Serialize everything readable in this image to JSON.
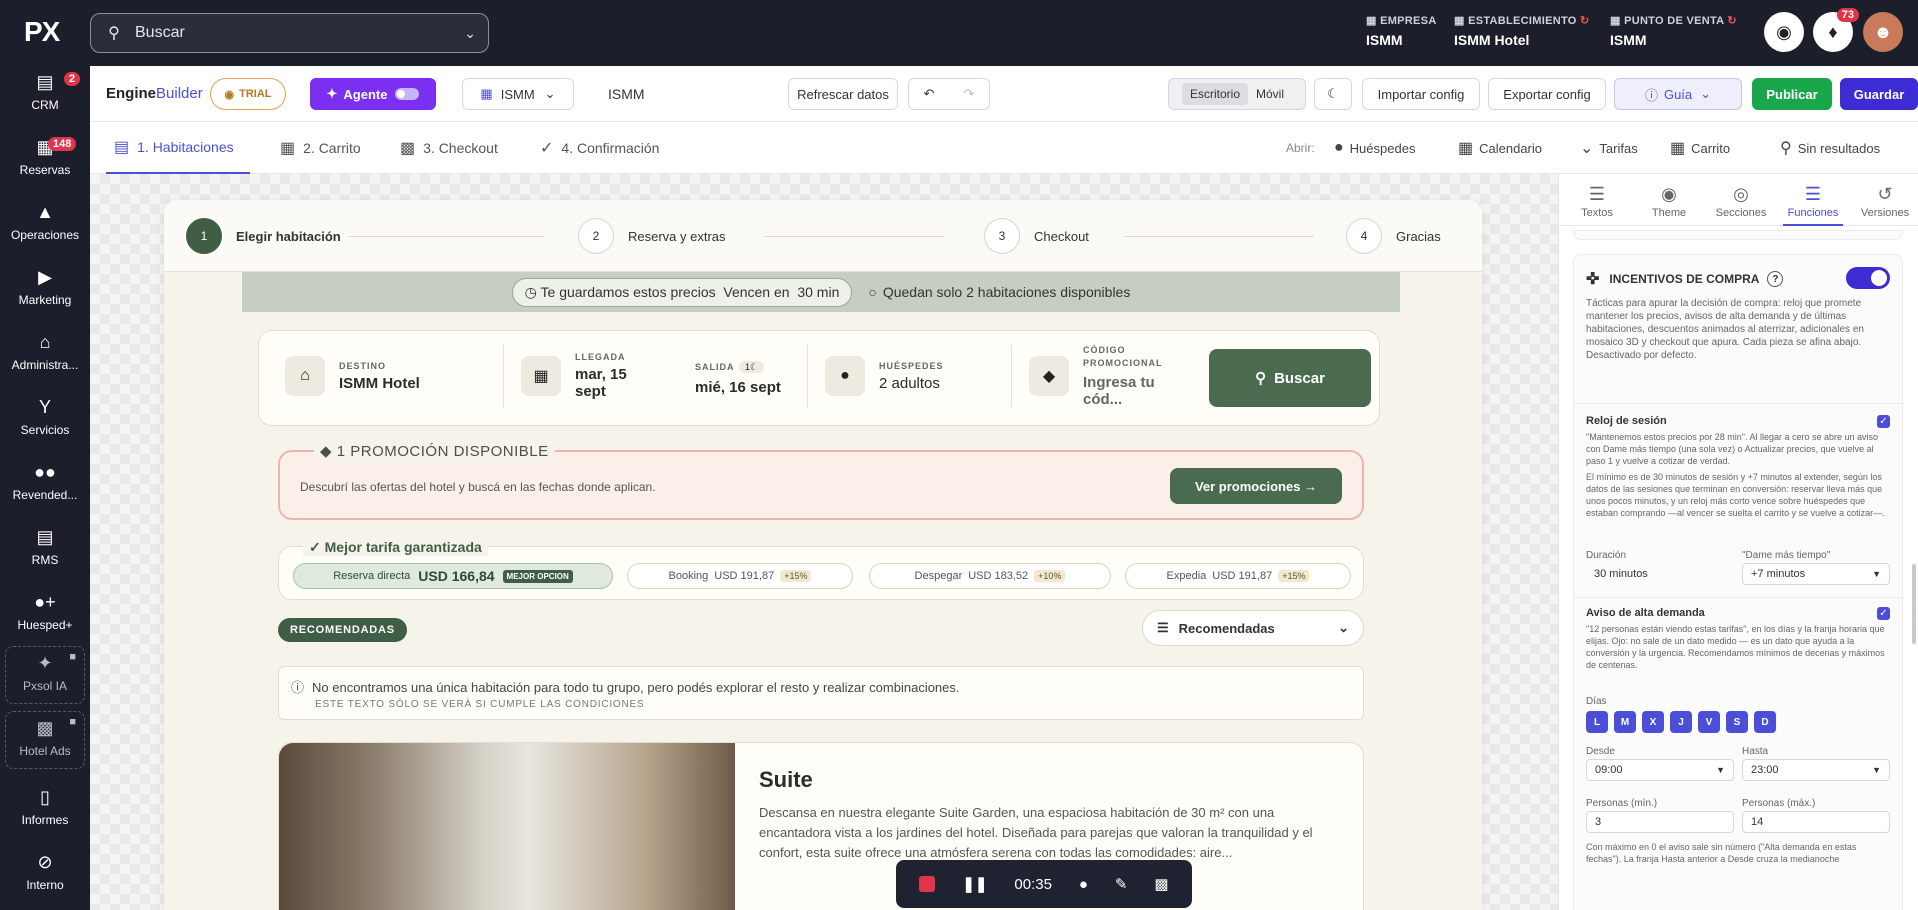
{
  "topbar": {
    "logo": "PX",
    "search_placeholder": "Buscar",
    "empresa_label": "EMPRESA",
    "empresa_value": "ISMM",
    "establecimiento_label": "ESTABLECIMIENTO",
    "establecimiento_value": "ISMM Hotel",
    "pdv_label": "PUNTO DE VENTA",
    "pdv_value": "ISMM",
    "notifications_count": "73"
  },
  "sidebar": {
    "items": [
      {
        "label": "CRM",
        "icon": "chat-icon",
        "badge": "2"
      },
      {
        "label": "Reservas",
        "icon": "calendar-icon",
        "badge": "148"
      },
      {
        "label": "Operaciones",
        "icon": "bell-icon"
      },
      {
        "label": "Marketing",
        "icon": "megaphone-icon"
      },
      {
        "label": "Administra...",
        "icon": "home-icon"
      },
      {
        "label": "Servicios",
        "icon": "cocktail-icon"
      },
      {
        "label": "Revended...",
        "icon": "users-icon"
      },
      {
        "label": "RMS",
        "icon": "chart-icon"
      },
      {
        "label": "Huesped+",
        "icon": "user-plus-icon"
      },
      {
        "label": "Pxsol IA",
        "icon": "sparkle-icon"
      },
      {
        "label": "Hotel Ads",
        "icon": "bars-icon"
      },
      {
        "label": "Informes",
        "icon": "document-icon"
      },
      {
        "label": "Interno",
        "icon": "block-icon"
      }
    ]
  },
  "toolbar": {
    "brand_a": "Engine",
    "brand_b": "Builder",
    "trial": "TRIAL",
    "agent": "Agente",
    "property": "ISMM",
    "property_name": "ISMM",
    "refresh": "Refrescar datos",
    "desktop": "Escritorio",
    "mobile": "Móvil",
    "import": "Importar config",
    "export": "Exportar config",
    "guide": "Guía",
    "publish": "Publicar",
    "save": "Guardar"
  },
  "steps_tabs": [
    {
      "label": "1. Habitaciones"
    },
    {
      "label": "2. Carrito"
    },
    {
      "label": "3. Checkout"
    },
    {
      "label": "4. Confirmación"
    }
  ],
  "open_links": {
    "label": "Abrir:",
    "items": [
      "Huéspedes",
      "Calendario",
      "Tarifas",
      "Carrito",
      "Sin resultados"
    ]
  },
  "preview": {
    "steps": [
      {
        "n": "1",
        "label": "Elegir habitación"
      },
      {
        "n": "2",
        "label": "Reserva y extras"
      },
      {
        "n": "3",
        "label": "Checkout"
      },
      {
        "n": "4",
        "label": "Gracias"
      }
    ],
    "timer_text": "Te guardamos estos precios  Vencen en  30 min",
    "availability_text": "Quedan solo 2 habitaciones disponibles",
    "search": {
      "destino_label": "DESTINO",
      "destino_value": "ISMM Hotel",
      "llegada_label": "LLEGADA",
      "llegada_value": "mar, 15 sept",
      "salida_label": "SALIDA",
      "salida_badge": "1",
      "salida_value": "mié, 16 sept",
      "huespedes_label": "HUÉSPEDES",
      "huespedes_value": "2 adultos",
      "codigo_label": "CÓDIGO PROMOCIONAL",
      "codigo_placeholder": "Ingresa tu cód...",
      "button": "Buscar"
    },
    "promo": {
      "title": "1 PROMOCIÓN DISPONIBLE",
      "text": "Descubrí las ofertas del hotel y buscá en las fechas donde aplican.",
      "button": "Ver promociones →"
    },
    "best_rate": {
      "title": "Mejor tarifa garantizada",
      "direct_label": "Reserva directa",
      "direct_price": "USD 166,84",
      "direct_tag": "MEJOR OPCION",
      "otas": [
        {
          "name": "Booking",
          "price": "USD 191,87",
          "pct": "+15%"
        },
        {
          "name": "Despegar",
          "price": "USD 183,52",
          "pct": "+10%"
        },
        {
          "name": "Expedia",
          "price": "USD 191,87",
          "pct": "+15%"
        }
      ]
    },
    "recommended_tag": "RECOMENDADAS",
    "sort_select": "Recomendadas",
    "notice_text": "No encontramos una única habitación para todo tu grupo, pero podés explorar el resto y realizar combinaciones.",
    "notice_sub": "ESTE TEXTO SÓLO SE VERÁ SI CUMPLE LAS CONDICIONES",
    "room_title": "Suite",
    "room_desc": "Descansa en nuestra elegante Suite Garden, una espaciosa habitación de 30 m² con una encantadora vista a los jardines del hotel. Diseñada para parejas que valoran la tranquilidad y el confort, esta suite ofrece una atmósfera serena con todas las comodidades: aire..."
  },
  "recorder": {
    "time": "00:35"
  },
  "right_panel": {
    "tabs": [
      {
        "label": "Textos",
        "icon": "text-icon"
      },
      {
        "label": "Theme",
        "icon": "palette-icon"
      },
      {
        "label": "Secciones",
        "icon": "eye-icon"
      },
      {
        "label": "Funciones",
        "icon": "sliders-icon"
      },
      {
        "label": "Versiones",
        "icon": "history-icon"
      }
    ],
    "section_title": "INCENTIVOS DE COMPRA",
    "section_desc": "Tácticas para apurar la decisión de compra: reloj que promete mantener los precios, avisos de alta demanda y de últimas habitaciones, descuentos animados al aterrizar, adicionales en mosaico 3D y checkout que apura. Cada pieza se afina abajo. Desactivado por defecto.",
    "session_clock": {
      "label": "Reloj de sesión",
      "desc1": "\"Mantenemos estos precios por 28 min\". Al llegar a cero se abre un aviso con Dame más tiempo (una sola vez) o Actualizar precios, que vuelve al paso 1 y vuelve a cotizar de verdad.",
      "desc2": "El mínimo es de 30 minutos de sesión y +7 minutos al extender, según los datos de las sesiones que terminan en conversión: reservar lleva más que unos pocos minutos, y un reloj más corto vence sobre huéspedes que estaban comprando —al vencer se suelta el carrito y se vuelve a cotizar—.",
      "duration_label": "Duración",
      "duration_value": "30 minutos",
      "more_label": "\"Dame más tiempo\"",
      "more_value": "+7 minutos"
    },
    "high_demand": {
      "label": "Aviso de alta demanda",
      "desc": "\"12 personas están viendo estas tarifas\", en los días y la franja horaria que elijas. Ojo: no sale de un dato medido — es un dato que ayuda a la conversión y la urgencia. Recomendamos mínimos de decenas y máximos de centenas.",
      "days_label": "Días",
      "days": [
        "L",
        "M",
        "X",
        "J",
        "V",
        "S",
        "D"
      ],
      "desde_label": "Desde",
      "desde_value": "09:00",
      "hasta_label": "Hasta",
      "hasta_value": "23:00",
      "min_label": "Personas (mín.)",
      "min_value": "3",
      "max_label": "Personas (máx.)",
      "max_value": "14",
      "footer": "Con máximo en 0 el aviso sale sin número (\"Alta demanda en estas fechas\"). La franja Hasta anterior a Desde cruza la medianoche"
    }
  }
}
